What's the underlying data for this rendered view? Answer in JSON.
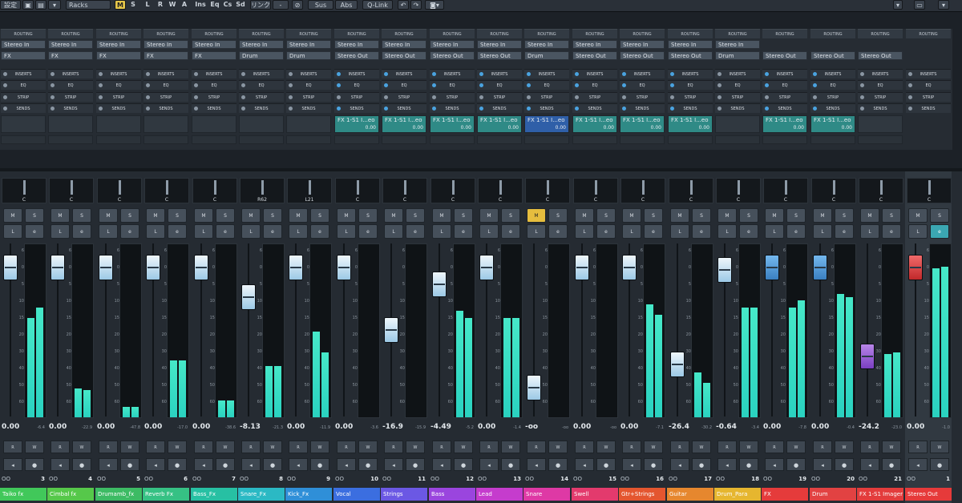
{
  "toolbar": {
    "settings": "設定",
    "racks": "Racks",
    "mode_m": "M",
    "mode_s": "S",
    "mode_l": "L",
    "mode_r": "R",
    "mode_w": "W",
    "mode_a": "A",
    "ins": "Ins",
    "eq": "Eq",
    "cs": "Cs",
    "sd": "Sd",
    "link": "リンク",
    "link_sep": "-",
    "sus": "Sus",
    "abs": "Abs",
    "qlink": "Q-Link"
  },
  "rack": {
    "routing_label": "ROUTING",
    "inserts_label": "INSERTS",
    "eq_label": "EQ",
    "strip_label": "STRIP",
    "sends_label": "SENDS"
  },
  "channels": [
    {
      "name": "Taiko fx",
      "num": "3",
      "in": "Stereo In",
      "out": "FX",
      "send": "",
      "send_val": "",
      "pan": "C",
      "vol": "0.00",
      "peak": "-6.4",
      "color": "#41c85a",
      "mute": false
    },
    {
      "name": "Cimbal fx",
      "num": "4",
      "in": "Stereo In",
      "out": "FX",
      "send": "",
      "send_val": "",
      "pan": "C",
      "vol": "0.00",
      "peak": "-22.9",
      "color": "#56c84a",
      "mute": false
    },
    {
      "name": "Drumamb_fx",
      "num": "5",
      "in": "Stereo In",
      "out": "FX",
      "send": "",
      "send_val": "",
      "pan": "C",
      "vol": "0.00",
      "peak": "-47.8",
      "color": "#3dbb64",
      "mute": false
    },
    {
      "name": "Reverb Fx",
      "num": "6",
      "in": "Stereo In",
      "out": "FX",
      "send": "",
      "send_val": "",
      "pan": "C",
      "vol": "0.00",
      "peak": "-17.0",
      "color": "#36c184",
      "mute": false
    },
    {
      "name": "Bass_Fx",
      "num": "7",
      "in": "Stereo In",
      "out": "FX",
      "send": "",
      "send_val": "",
      "pan": "C",
      "vol": "0.00",
      "peak": "-38.6",
      "color": "#27c0a3",
      "mute": false
    },
    {
      "name": "Snare_Fx",
      "num": "8",
      "in": "Stereo In",
      "out": "Drum",
      "send": "",
      "send_val": "",
      "pan": "R62",
      "vol": "-8.13",
      "peak": "-21.3",
      "color": "#2bb9c4",
      "mute": false
    },
    {
      "name": "Kick_Fx",
      "num": "9",
      "in": "Stereo In",
      "out": "Drum",
      "send": "",
      "send_val": "",
      "pan": "L21",
      "vol": "0.00",
      "peak": "-11.9",
      "color": "#2f8fd8",
      "mute": false
    },
    {
      "name": "Vocal",
      "num": "10",
      "in": "Stereo In",
      "out": "Stereo Out",
      "send": "FX 1-S1 I...eo",
      "send_val": "0.00",
      "pan": "C",
      "vol": "0.00",
      "peak": "-3.6",
      "color": "#3b6ee0",
      "mute": false
    },
    {
      "name": "Strings",
      "num": "11",
      "in": "Stereo In",
      "out": "Stereo Out",
      "send": "FX 1-S1 I...eo",
      "send_val": "0.00",
      "pan": "C",
      "vol": "-16.9",
      "peak": "-15.9",
      "color": "#6b58e4",
      "mute": false
    },
    {
      "name": "Bass",
      "num": "12",
      "in": "Stereo In",
      "out": "Stereo Out",
      "send": "FX 1-S1 I...eo",
      "send_val": "0.00",
      "pan": "C",
      "vol": "-4.49",
      "peak": "-5.2",
      "color": "#9a45de",
      "mute": false
    },
    {
      "name": "Lead",
      "num": "13",
      "in": "Stereo In",
      "out": "Stereo Out",
      "send": "FX 1-S1 I...eo",
      "send_val": "0.00",
      "pan": "C",
      "vol": "0.00",
      "peak": "-1.4",
      "color": "#c53ccd",
      "mute": false
    },
    {
      "name": "Snare",
      "num": "14",
      "in": "Stereo In",
      "out": "Drum",
      "send": "FX 1-S1 I...eo",
      "send_val": "0.00",
      "pan": "C",
      "vol": "-oo",
      "peak": "-oo",
      "color": "#de39a5",
      "mute": true
    },
    {
      "name": "Swell",
      "num": "15",
      "in": "Stereo In",
      "out": "Stereo Out",
      "send": "FX 1-S1 I...eo",
      "send_val": "0.00",
      "pan": "C",
      "vol": "0.00",
      "peak": "-oo",
      "color": "#e33a6d",
      "mute": false
    },
    {
      "name": "Gtr+Strings",
      "num": "16",
      "in": "Stereo In",
      "out": "Stereo Out",
      "send": "FX 1-S1 I...eo",
      "send_val": "0.00",
      "pan": "C",
      "vol": "0.00",
      "peak": "-7.1",
      "color": "#e4562f",
      "mute": false
    },
    {
      "name": "Guitar",
      "num": "17",
      "in": "Stereo In",
      "out": "Stereo Out",
      "send": "FX 1-S1 I...eo",
      "send_val": "0.00",
      "pan": "C",
      "vol": "-26.4",
      "peak": "-30.2",
      "color": "#e6872e",
      "mute": false
    },
    {
      "name": "Drum_Para",
      "num": "18",
      "in": "Stereo In",
      "out": "Drum",
      "send": "",
      "send_val": "",
      "pan": "C",
      "vol": "-0.64",
      "peak": "-3.4",
      "color": "#e6b62f",
      "mute": false
    },
    {
      "name": "FX",
      "num": "19",
      "in": "",
      "out": "Stereo Out",
      "send": "FX 1-S1 I...eo",
      "send_val": "0.00",
      "pan": "C",
      "vol": "0.00",
      "peak": "-7.8",
      "color": "#e53b3b",
      "mute": false
    },
    {
      "name": "Drum",
      "num": "20",
      "in": "",
      "out": "Stereo Out",
      "send": "FX 1-S1 I...eo",
      "send_val": "0.00",
      "pan": "C",
      "vol": "0.00",
      "peak": "-0.4",
      "color": "#e24242",
      "mute": false
    },
    {
      "name": "FX 1-S1 Imager",
      "num": "21",
      "in": "",
      "out": "Stereo Out",
      "send": "",
      "send_val": "",
      "pan": "C",
      "vol": "-24.2",
      "peak": "-23.0",
      "color": "#e33c3c",
      "mute": false
    },
    {
      "name": "Stereo Out",
      "num": "1",
      "in": "",
      "out": "",
      "send": "",
      "send_val": "",
      "pan": "C",
      "vol": "0.00",
      "peak": "-1.0",
      "color": "#e63a3a",
      "mute": false
    }
  ],
  "fader_positions": [
    0.0,
    0.0,
    0.0,
    0.0,
    0.0,
    -8.13,
    0.0,
    0.0,
    -16.9,
    -4.49,
    0.0,
    -90,
    0.0,
    0.0,
    -26.4,
    -0.64,
    0.0,
    0.0,
    -24.2,
    0.0
  ],
  "meter_levels": [
    0.58,
    0.17,
    0.06,
    0.33,
    0.1,
    0.3,
    0.5,
    0.0,
    0.0,
    0.62,
    0.58,
    0.0,
    0.0,
    0.66,
    0.26,
    0.64,
    0.64,
    0.72,
    0.37,
    0.87
  ],
  "meter_levels_r": [
    0.64,
    0.16,
    0.06,
    0.33,
    0.1,
    0.3,
    0.38,
    0.0,
    0.0,
    0.58,
    0.58,
    0.0,
    0.0,
    0.6,
    0.2,
    0.64,
    0.68,
    0.7,
    0.38,
    0.88
  ],
  "button_labels": {
    "m": "M",
    "s": "S",
    "l": "L",
    "e": "e",
    "r": "R",
    "w": "W",
    "link": "OO"
  },
  "scale_ticks": [
    "6",
    "0",
    "5",
    "10",
    "15",
    "20",
    "30",
    "40",
    "50",
    "60"
  ]
}
